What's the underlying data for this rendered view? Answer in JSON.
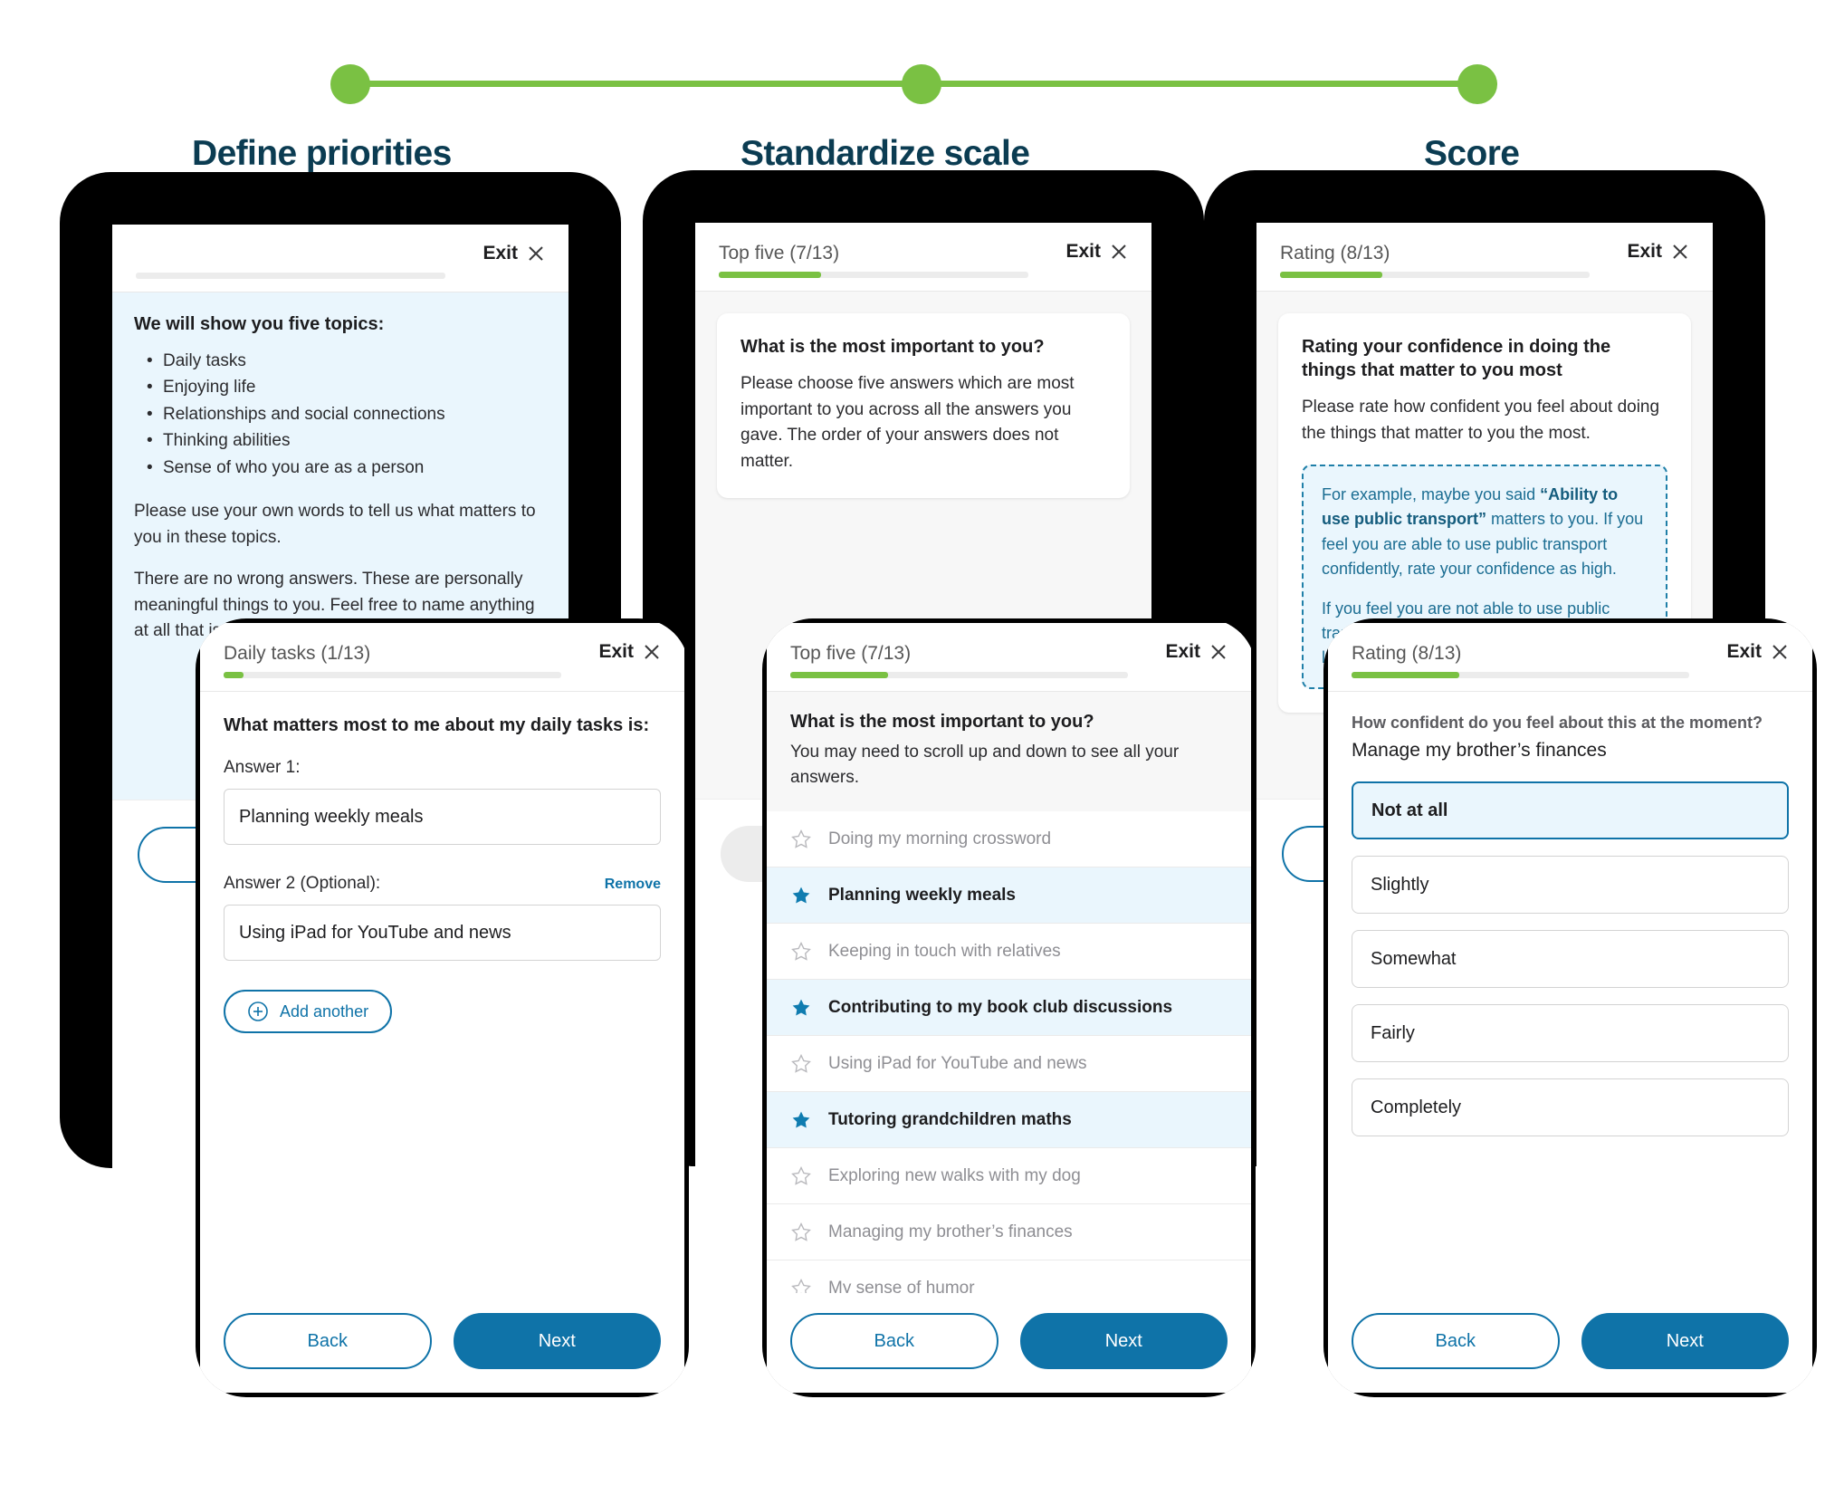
{
  "steps": {
    "labels": [
      "Define priorities",
      "Standardize scale",
      "Score"
    ],
    "accent_color": "#7ac143",
    "heading_color": "#0b3c52"
  },
  "common": {
    "exit_label": "Exit",
    "exit_icon": "close-icon",
    "back_label": "Back",
    "next_label": "Next",
    "accent_blue": "#0f73a8",
    "highlight_blue": "#eaf6fd"
  },
  "screen1_back": {
    "header": {
      "title": "",
      "progress_percent": 0
    },
    "lead": "We will show you five topics:",
    "topics": [
      "Daily tasks",
      "Enjoying life",
      "Relationships and social connections",
      "Thinking abilities",
      "Sense of who you are as a person"
    ],
    "paragraph1": "Please use your own words to tell us what matters to you in these topics.",
    "paragraph2": "There are no wrong answers. These are personally meaningful things to you. Feel free to name anything at all that is important for you to hold on to."
  },
  "screen1_front": {
    "header": {
      "title": "Daily tasks (1/13)",
      "progress_percent": 6
    },
    "question": "What matters most to me about my daily tasks is:",
    "answer1_label": "Answer 1:",
    "answer1_value": "Planning weekly meals",
    "answer2_label": "Answer 2 (Optional):",
    "answer2_value": "Using iPad for YouTube and news",
    "remove_label": "Remove",
    "add_another_label": "Add another",
    "add_another_icon": "plus-circle-icon"
  },
  "screen2_back": {
    "header": {
      "title": "Top five (7/13)",
      "progress_percent": 33
    },
    "card_title": "What is the most important to you?",
    "card_text": "Please choose five answers which are most important to you across all the answers you gave. The order of your answers does not matter."
  },
  "screen2_front": {
    "header": {
      "title": "Top five (7/13)",
      "progress_percent": 29
    },
    "question": "What is the most important to you?",
    "hint": "You may need to scroll up and down to see all your answers.",
    "options": [
      {
        "label": "Doing my morning crossword",
        "selected": false
      },
      {
        "label": "Planning weekly meals",
        "selected": true
      },
      {
        "label": "Keeping in touch with relatives",
        "selected": false
      },
      {
        "label": "Contributing to my book club discussions",
        "selected": true
      },
      {
        "label": "Using iPad for YouTube and news",
        "selected": false
      },
      {
        "label": "Tutoring grandchildren maths",
        "selected": true
      },
      {
        "label": "Exploring new walks with my dog",
        "selected": false
      },
      {
        "label": "Managing my brother’s finances",
        "selected": false
      },
      {
        "label": "My sense of humor",
        "selected": false
      }
    ],
    "star_icon_selected": "star-filled-icon",
    "star_icon_empty": "star-outline-icon"
  },
  "screen3_back": {
    "header": {
      "title": "Rating (8/13)",
      "progress_percent": 33
    },
    "card_title": "Rating your confidence in doing the things that matter to you most",
    "card_text": "Please rate how confident you feel about doing the things that matter to you the most.",
    "example_part1_pre": "For example, maybe you said ",
    "example_bold": "“Ability to use public transport”",
    "example_part1_post": " matters to you. If you feel you are able to use public transport confidently, rate your confidence as high.",
    "example_part2": "If you feel you are not able to use public transport confidently, rate your confidence as low."
  },
  "screen3_front": {
    "header": {
      "title": "Rating (8/13)",
      "progress_percent": 32
    },
    "sub_question": "How confident do you feel about this at the moment?",
    "item": "Manage my brother’s finances",
    "options": [
      {
        "label": "Not at all",
        "selected": true
      },
      {
        "label": "Slightly",
        "selected": false
      },
      {
        "label": "Somewhat",
        "selected": false
      },
      {
        "label": "Fairly",
        "selected": false
      },
      {
        "label": "Completely",
        "selected": false
      }
    ]
  }
}
